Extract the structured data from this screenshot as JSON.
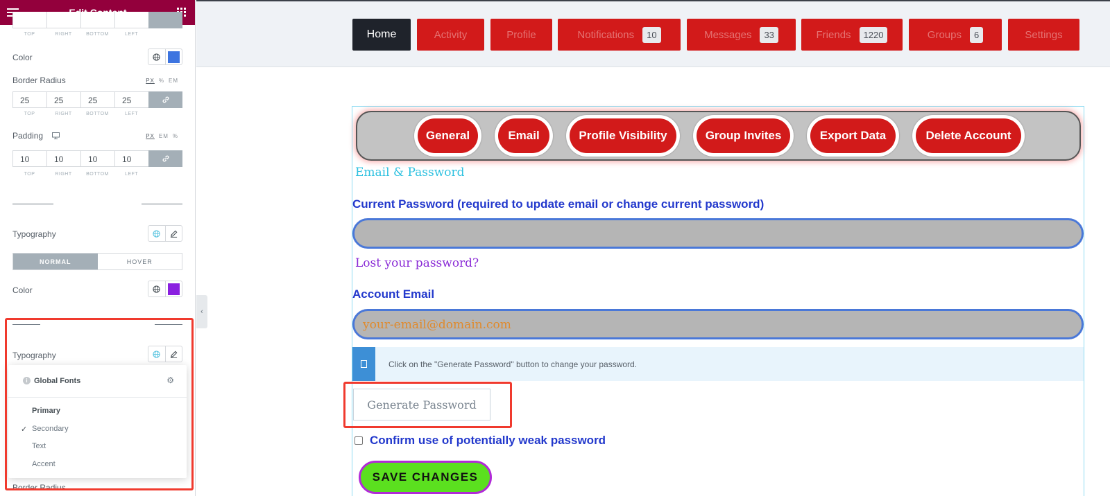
{
  "panel": {
    "title": "Edit Content",
    "top_dim_labels": [
      "TOP",
      "RIGHT",
      "BOTTOM",
      "LEFT"
    ],
    "color1": {
      "label": "Color",
      "swatch": "#3d74e0"
    },
    "border_radius": {
      "label": "Border Radius",
      "units": [
        "PX",
        "%",
        "EM"
      ],
      "values": [
        "25",
        "25",
        "25",
        "25"
      ],
      "dim_labels": [
        "TOP",
        "RIGHT",
        "BOTTOM",
        "LEFT"
      ]
    },
    "padding": {
      "label": "Padding",
      "units": [
        "PX",
        "EM",
        "%"
      ],
      "values": [
        "10",
        "10",
        "10",
        "10"
      ],
      "dim_labels": [
        "TOP",
        "RIGHT",
        "BOTTOM",
        "LEFT"
      ]
    },
    "typography1": {
      "label": "Typography"
    },
    "state_toggle": {
      "normal": "NORMAL",
      "hover": "HOVER"
    },
    "color2": {
      "label": "Color",
      "swatch": "#8a1fe0"
    },
    "typography2": {
      "label": "Typography"
    },
    "fonts_popup": {
      "title": "Global Fonts",
      "items": [
        "Primary",
        "Secondary",
        "Text",
        "Accent"
      ],
      "selected": "Secondary"
    },
    "bottom_label": "Border Radius"
  },
  "nav": {
    "items": [
      {
        "label": "Home"
      },
      {
        "label": "Activity"
      },
      {
        "label": "Profile"
      },
      {
        "label": "Notifications",
        "count": "10"
      },
      {
        "label": "Messages",
        "count": "33"
      },
      {
        "label": "Friends",
        "count": "1220"
      },
      {
        "label": "Groups",
        "count": "6"
      },
      {
        "label": "Settings"
      }
    ]
  },
  "tabs": [
    "General",
    "Email",
    "Profile Visibility",
    "Group Invites",
    "Export Data",
    "Delete Account"
  ],
  "form": {
    "section_title": "Email & Password",
    "current_password_label": "Current Password (required to update email or change current password)",
    "lost_password": "Lost your password?",
    "account_email_label": "Account Email",
    "account_email_value": "your-email@domain.com",
    "notice": "Click on the \"Generate Password\" button to change your password.",
    "generate_button": "Generate Password",
    "weak_password_label": "Confirm use of potentially weak password",
    "save_button": "SAVE CHANGES"
  },
  "colors": {
    "panel_header": "#93003c",
    "nav_red": "#d21a1a",
    "nav_home": "#1f232b",
    "annotation_red": "#f03a2e"
  }
}
